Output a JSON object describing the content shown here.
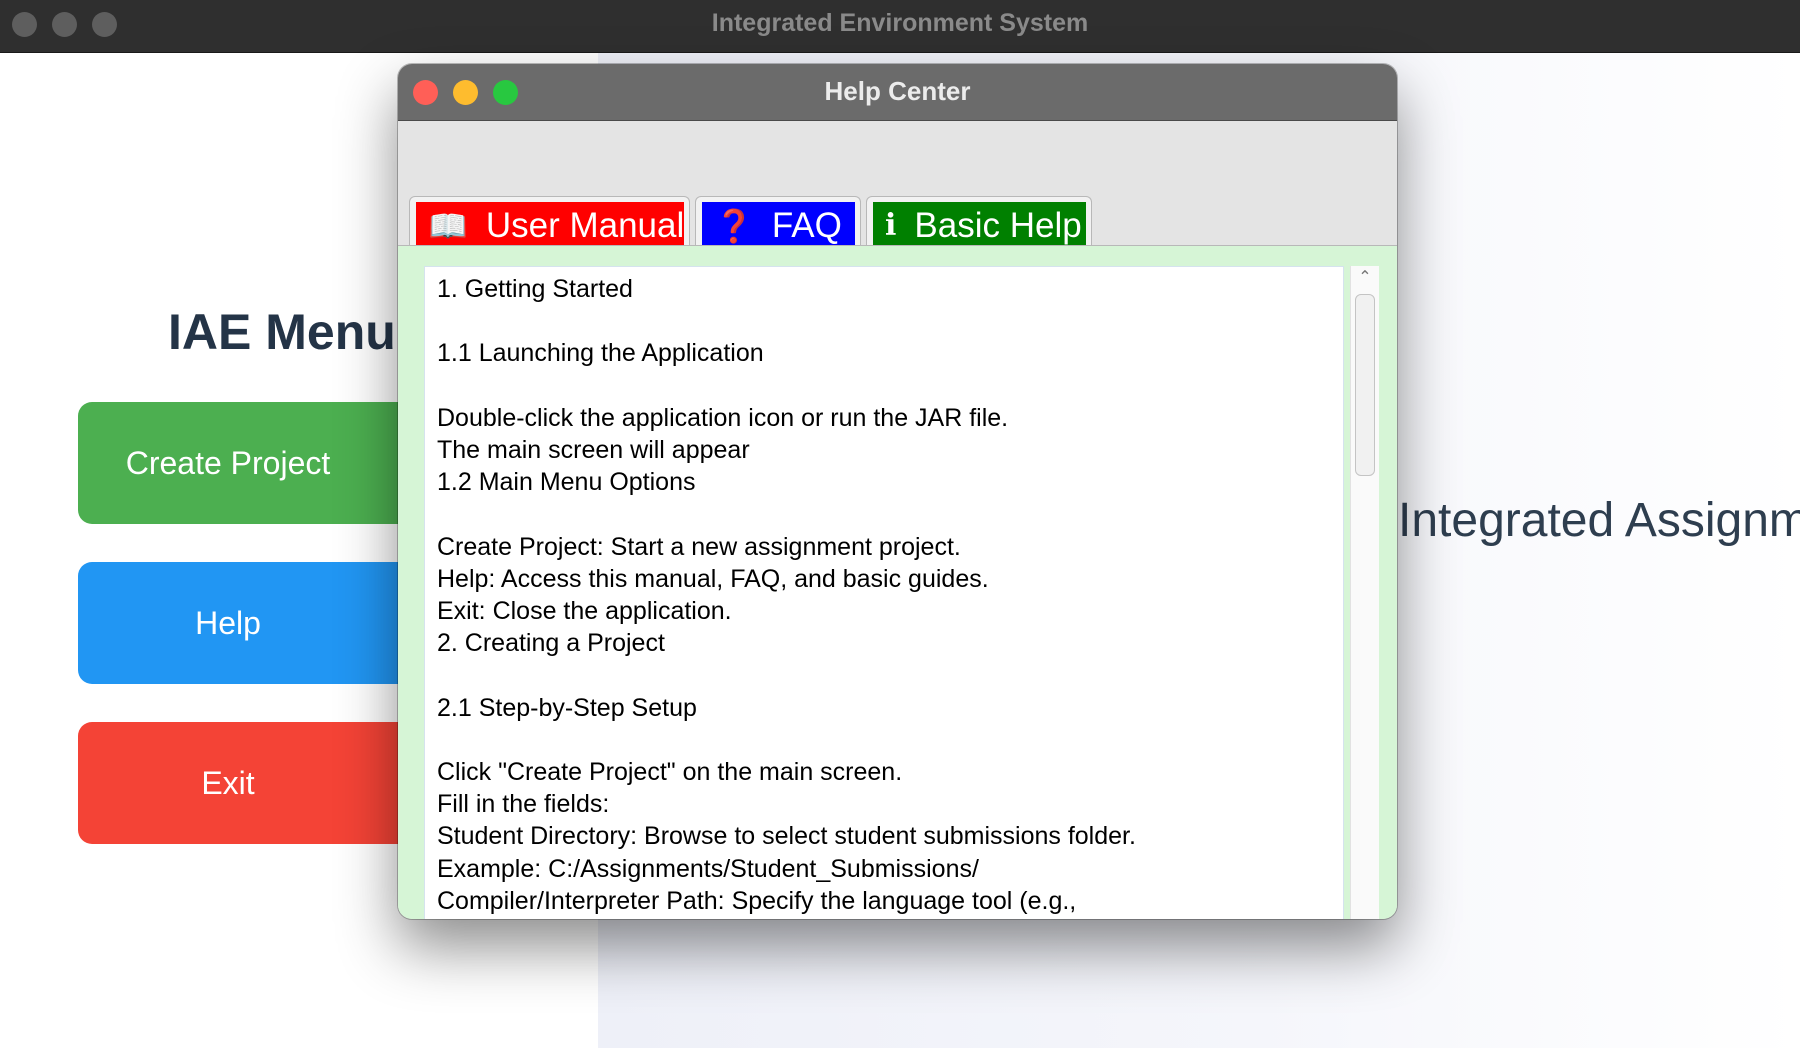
{
  "main_window": {
    "title": "Integrated Environment System",
    "menu_title": "IAE Menu",
    "buttons": {
      "create": "Create Project",
      "help": "Help",
      "exit": "Exit"
    },
    "env_text": "Integrated Assignment Environment"
  },
  "help_window": {
    "title": "Help Center",
    "tabs": [
      {
        "icon": "📖",
        "label": "User Manual",
        "color": "#ff0000"
      },
      {
        "icon": "❓",
        "label": "FAQ",
        "color": "#0000ff"
      },
      {
        "icon": "i",
        "label": "Basic Help",
        "color": "#008000"
      }
    ],
    "selected_tab": "User Manual",
    "manual_text": "1. Getting Started\n\n1.1 Launching the Application\n\nDouble-click the application icon or run the JAR file.\nThe main screen will appear\n1.2 Main Menu Options\n\nCreate Project: Start a new assignment project.\nHelp: Access this manual, FAQ, and basic guides.\nExit: Close the application.\n2. Creating a Project\n\n2.1 Step-by-Step Setup\n\nClick \"Create Project\" on the main screen.\nFill in the fields:\nStudent Directory: Browse to select student submissions folder.\nExample: C:/Assignments/Student_Submissions/\nCompiler/Interpreter Path: Specify the language tool (e.g.,\nC:/Python/python.exe).\nArguments: Add compiler flags (e.g., -O for optimization)."
  },
  "colors": {
    "create_button": "#4caf50",
    "help_button": "#2196f3",
    "exit_button": "#f44336",
    "help_content_bg": "#d6f5d6"
  }
}
